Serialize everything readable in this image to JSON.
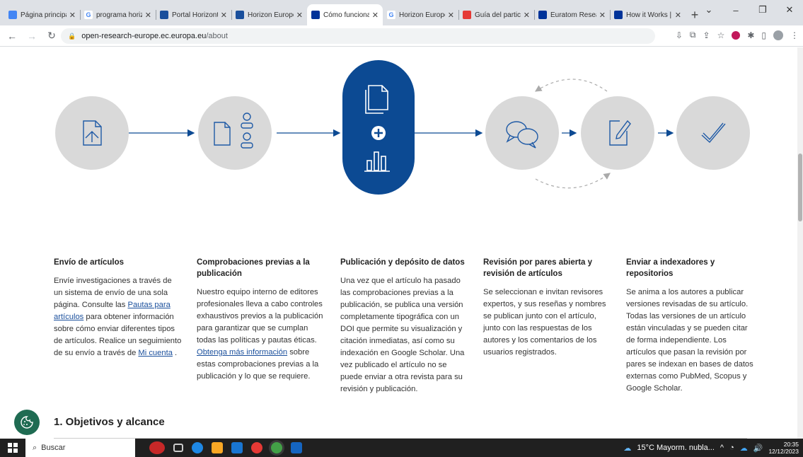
{
  "browser": {
    "tabs": [
      {
        "title": "Página principal",
        "favicon": "drive-icon",
        "color": "#4285f4",
        "active": false
      },
      {
        "title": "programa horizonte",
        "favicon": "google-icon",
        "color": "#ffffff",
        "active": false
      },
      {
        "title": "Portal Horizonte",
        "favicon": "site-icon",
        "color": "#1a4f9c",
        "active": false
      },
      {
        "title": "Horizon Europe",
        "favicon": "site-icon",
        "color": "#1a4f9c",
        "active": false
      },
      {
        "title": "Cómo funciona",
        "favicon": "eu-flag-icon",
        "color": "#003399",
        "active": true
      },
      {
        "title": "Horizon Europe",
        "favicon": "google-icon",
        "color": "#ffffff",
        "active": false
      },
      {
        "title": "Guía del participante",
        "favicon": "pdf-icon",
        "color": "#e53935",
        "active": false
      },
      {
        "title": "Euratom Research",
        "favicon": "eu-flag-icon",
        "color": "#003399",
        "active": false
      },
      {
        "title": "How it Works |",
        "favicon": "eu-flag-icon",
        "color": "#003399",
        "active": false
      }
    ],
    "new_tab": "+",
    "url_host": "open-research-europe.ec.europa.eu",
    "url_path": "/about"
  },
  "diagram": {
    "steps": [
      "upload-document-icon",
      "documents-users-icon",
      "publish-data-icon",
      "chat-bubbles-icon",
      "edit-document-icon",
      "checkmark-icon"
    ],
    "active_color": "#0c4a93",
    "inactive_color": "#d9d9d9",
    "icon_color": "#1f5aa6"
  },
  "columns": [
    {
      "title": "Envío de artículos",
      "parts": [
        {
          "text": "Envíe investigaciones a través de un sistema de envío de una sola página. Consulte las "
        },
        {
          "text": "Pautas para artículos",
          "link": true
        },
        {
          "text": " para obtener información sobre cómo enviar diferentes tipos de artículos. Realice un seguimiento de su envío a través de "
        },
        {
          "text": "Mi cuenta",
          "link": true
        },
        {
          "text": " ."
        }
      ]
    },
    {
      "title": "Comprobaciones previas a la publicación",
      "parts": [
        {
          "text": "Nuestro equipo interno de editores profesionales lleva a cabo controles exhaustivos previos a la publicación para garantizar que se cumplan todas las políticas y pautas éticas. "
        },
        {
          "text": "Obtenga más información",
          "link": true
        },
        {
          "text": " sobre estas comprobaciones previas a la publicación y lo que se requiere."
        }
      ]
    },
    {
      "title": "Publicación y depósito de datos",
      "parts": [
        {
          "text": "Una vez que el artículo ha pasado las comprobaciones previas a la publicación, se publica una versión completamente tipográfica con un DOI que permite su visualización y citación inmediatas, así como su indexación en Google Scholar. Una vez publicado el artículo no se puede enviar a otra revista para su revisión y publicación."
        }
      ]
    },
    {
      "title": "Revisión por pares abierta y revisión de artículos",
      "parts": [
        {
          "text": "Se seleccionan e invitan revisores expertos, y sus reseñas y nombres se publican junto con el artículo, junto con las respuestas de los autores y los comentarios de los usuarios registrados."
        }
      ]
    },
    {
      "title": "Enviar a indexadores y repositorios",
      "parts": [
        {
          "text": "Se anima a los autores a publicar versiones revisadas de su artículo. Todas las versiones de un artículo están vinculadas y se pueden citar de forma independiente. Los artículos que pasan la revisión por pares se indexan en bases de datos externas como PubMed, Scopus y Google Scholar."
        }
      ]
    }
  ],
  "section": {
    "title": "1. Objetivos y alcance"
  },
  "taskbar": {
    "search_label": "Buscar",
    "weather": "15°C  Mayorm. nubla...",
    "time": "20:35",
    "date": "12/12/2023"
  }
}
